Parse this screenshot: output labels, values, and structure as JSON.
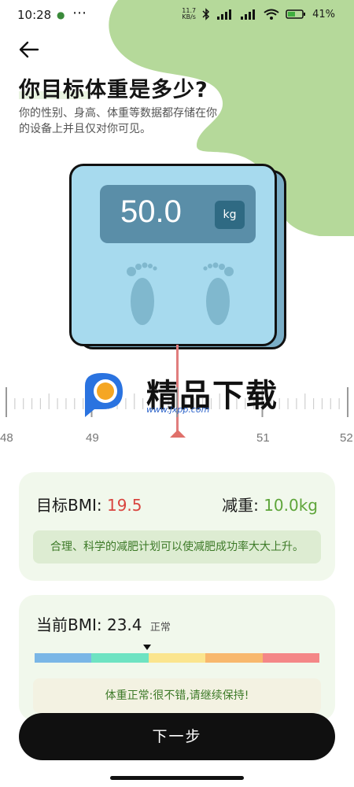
{
  "status_bar": {
    "time": "10:28",
    "net_speed_top": "11.7",
    "net_speed_unit": "KB/s",
    "battery": "41%"
  },
  "header": {
    "title": "你目标体重是多少?",
    "subtitle": "你的性别、身高、体重等数据都存储在你的设备上并且仅对你可见。"
  },
  "scale": {
    "value": "50.0",
    "unit": "kg"
  },
  "ruler": {
    "labels": [
      "48",
      "49",
      "51",
      "52"
    ]
  },
  "watermark": {
    "text": "精品下载",
    "url": "www.jxpp.com"
  },
  "target_card": {
    "bmi_label": "目标BMI:",
    "bmi_value": "19.5",
    "loss_label": "减重:",
    "loss_value": "10.0kg",
    "tip": "合理、科学的减肥计划可以使减肥成功率大大上升。"
  },
  "current_card": {
    "bmi_label": "当前BMI:",
    "bmi_value": "23.4",
    "bmi_status": "正常",
    "tip": "体重正常:很不错,请继续保持!",
    "bar_colors": [
      "#7ab6e6",
      "#6ee3c2",
      "#fbe58e",
      "#f8b86d",
      "#f48787"
    ]
  },
  "buttons": {
    "next": "下一步"
  },
  "colors": {
    "accent_green": "#b5d99a",
    "scale_blue": "#a7daee",
    "indicator_red": "#e07d7d"
  }
}
